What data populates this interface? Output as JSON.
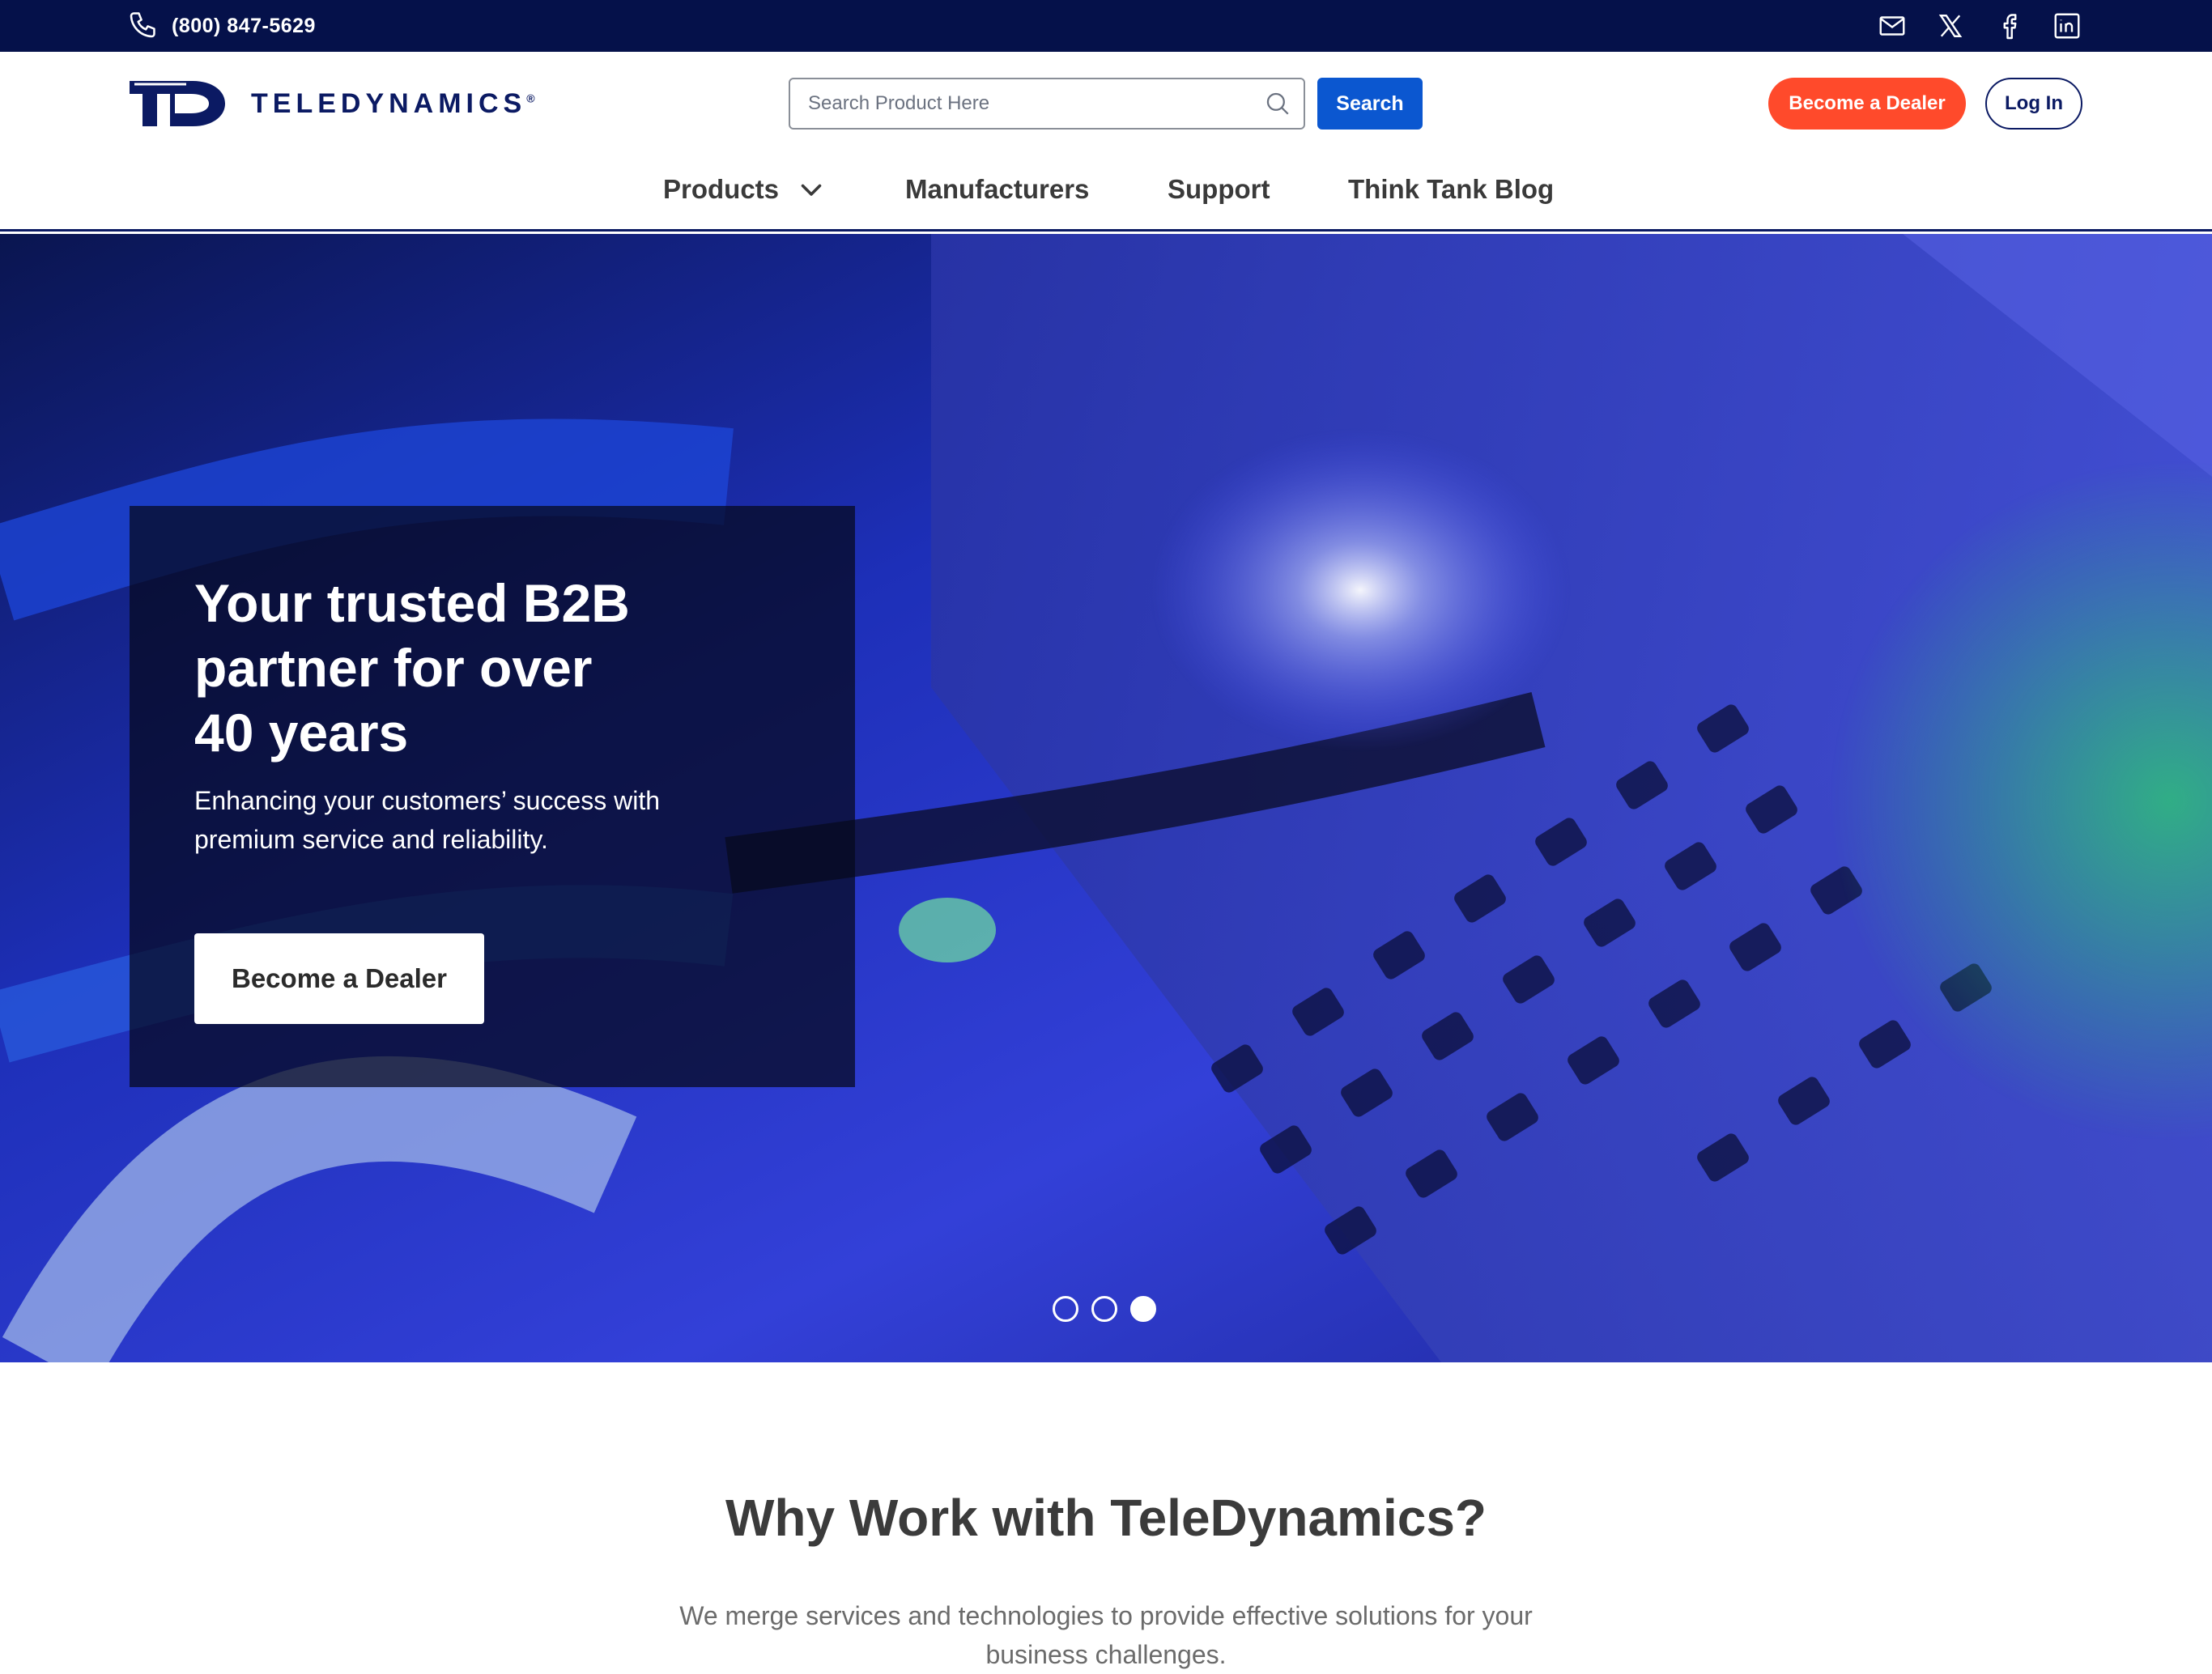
{
  "topbar": {
    "phone": "(800) 847-5629",
    "icons": [
      "phone-icon",
      "mail-icon",
      "x-icon",
      "facebook-icon",
      "linkedin-icon"
    ]
  },
  "header": {
    "logo_text": "TELEDYNAMICS",
    "logo_mark": "®",
    "search_placeholder": "Search Product Here",
    "search_button": "Search",
    "dealer_button": "Become a Dealer",
    "login_button": "Log In"
  },
  "nav": {
    "items": [
      {
        "label": "Products"
      },
      {
        "label": "Manufacturers"
      },
      {
        "label": "Support"
      },
      {
        "label": "Think Tank Blog"
      }
    ]
  },
  "hero": {
    "title_lines": [
      "Your trusted B2B",
      "partner for over",
      "40 years"
    ],
    "subtitle_lines": [
      "Enhancing your customers’ success with",
      "premium service and reliability."
    ],
    "cta": "Become a Dealer",
    "slides_total": 3,
    "active_slide": 3
  },
  "why": {
    "title": "Why Work with TeleDynamics?",
    "subtitle": "We merge services and technologies to provide effective solutions for your business challenges."
  },
  "colors": {
    "topbar": "#05114a",
    "brand_navy": "#0b1a63",
    "search_blue": "#0b57d0",
    "dealer_orange": "#ff4a2b"
  }
}
